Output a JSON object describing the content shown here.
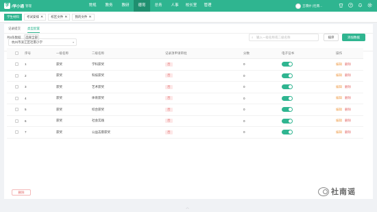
{
  "app": {
    "logo_text": "/学小通",
    "logo_sub": "管理",
    "user_name": "王璞纱 (社南..."
  },
  "nav": {
    "items": [
      {
        "label": "常规",
        "active": false
      },
      {
        "label": "教务",
        "active": false
      },
      {
        "label": "教研",
        "active": false
      },
      {
        "label": "德育",
        "active": true
      },
      {
        "label": "总务",
        "active": false
      },
      {
        "label": "人事",
        "active": false
      },
      {
        "label": "校长室",
        "active": false
      },
      {
        "label": "管理",
        "active": false
      }
    ]
  },
  "icons": {
    "logo": "logo-mark",
    "avatar": "avatar",
    "top": [
      "shirt-icon",
      "help-icon",
      "bell-icon",
      "gear-icon"
    ],
    "search": "search-icon",
    "close": "close-icon",
    "caret": "chevron-down-icon"
  },
  "tabs": [
    {
      "label": "学生材料",
      "active": true,
      "closable": false
    },
    {
      "label": "考试安排",
      "active": false,
      "closable": true
    },
    {
      "label": "校区文件",
      "active": false,
      "closable": true
    },
    {
      "label": "我的文件",
      "active": false,
      "closable": true
    }
  ],
  "subtabs": [
    {
      "label": "记录提交",
      "active": false
    },
    {
      "label": "类型配置",
      "active": true
    }
  ],
  "school_select": {
    "value": "杭州市滨江区社南小学"
  },
  "toolbar": {
    "count_text": "共8条数据",
    "choose_all_label": "选择全部",
    "search_placeholder": "输入一级名称或二级名称",
    "sort_label": "排序",
    "add_label": "添加数据",
    "delete_label": "删除"
  },
  "table": {
    "headers": [
      "序号",
      "一级名称",
      "二级名称",
      "记录须申请审批",
      "分数",
      "电子证书",
      "操作"
    ],
    "rows": [
      {
        "no": "1",
        "level1": "获奖",
        "level2": "学科获奖",
        "approval": "否",
        "score": "0",
        "cert_on": true,
        "edit": "编辑",
        "del": "删除"
      },
      {
        "no": "2",
        "level1": "获奖",
        "level2": "科技获奖",
        "approval": "否",
        "score": "0",
        "cert_on": true,
        "edit": "编辑",
        "del": "删除"
      },
      {
        "no": "3",
        "level1": "获奖",
        "level2": "艺术获奖",
        "approval": "否",
        "score": "0",
        "cert_on": true,
        "edit": "编辑",
        "del": "删除"
      },
      {
        "no": "4",
        "level1": "获奖",
        "level2": "体育获奖",
        "approval": "否",
        "score": "0",
        "cert_on": true,
        "edit": "编辑",
        "del": "删除"
      },
      {
        "no": "5",
        "level1": "获奖",
        "level2": "综合获奖",
        "approval": "否",
        "score": "0",
        "cert_on": true,
        "edit": "编辑",
        "del": "删除"
      },
      {
        "no": "6",
        "level1": "获奖",
        "level2": "社会实践",
        "approval": "否",
        "score": "0",
        "cert_on": true,
        "edit": "编辑",
        "del": "删除"
      },
      {
        "no": "7",
        "level1": "获奖",
        "level2": "公益志愿获奖",
        "approval": "否",
        "score": "0",
        "cert_on": true,
        "edit": "编辑",
        "del": "删除"
      }
    ]
  },
  "watermark": {
    "text": "社南谣"
  },
  "colors": {
    "accent": "#2fb590",
    "danger": "#e26a6a",
    "warning": "#f0a050"
  }
}
